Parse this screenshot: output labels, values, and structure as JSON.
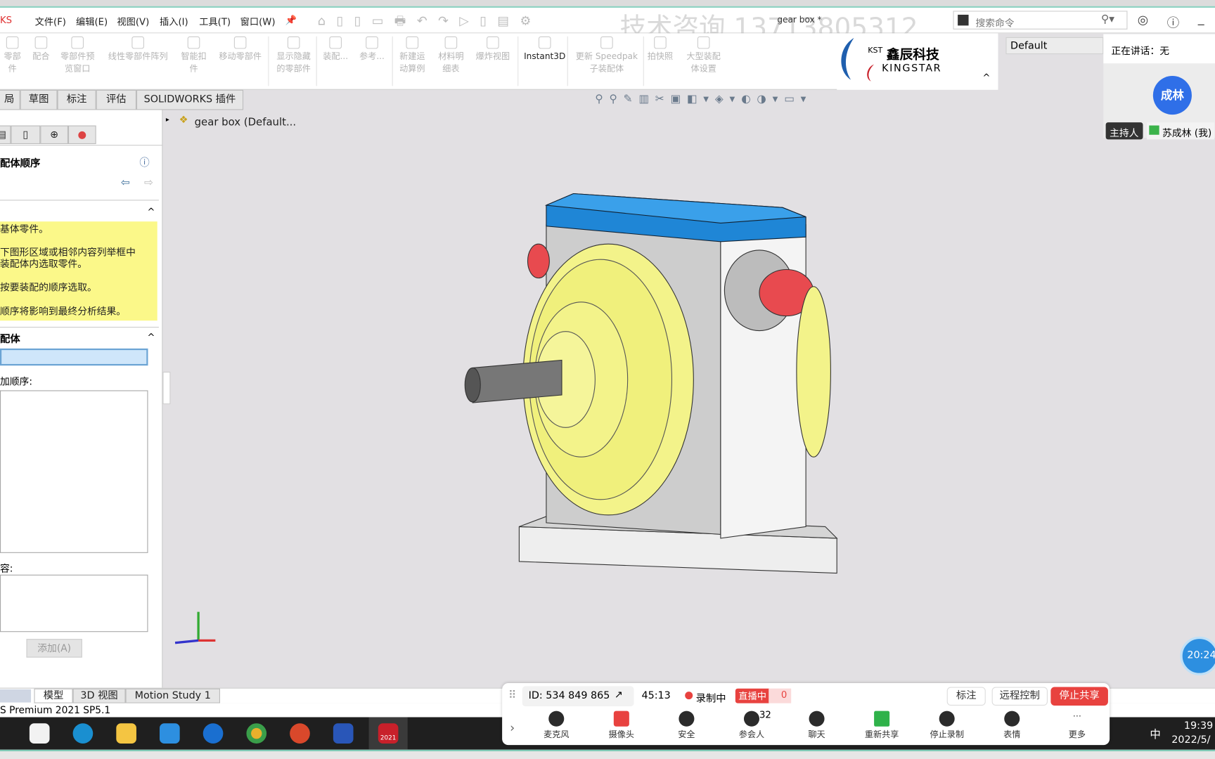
{
  "app": {
    "brand_fragment": "KS",
    "doc_title": "gear box *",
    "watermark": "技术咨询 13713805312"
  },
  "menu": [
    "文件(F)",
    "编辑(E)",
    "视图(V)",
    "插入(I)",
    "工具(T)",
    "窗口(W)"
  ],
  "search": {
    "placeholder": "搜索命令"
  },
  "ribbon": [
    {
      "l1": "零部件",
      "l2": ""
    },
    {
      "l1": "配合",
      "l2": ""
    },
    {
      "l1": "零部件预",
      "l2": "览窗口"
    },
    {
      "l1": "线性零部件阵列",
      "l2": ""
    },
    {
      "l1": "智能扣",
      "l2": "件"
    },
    {
      "l1": "移动零部件",
      "l2": ""
    },
    {
      "l1": "显示隐藏",
      "l2": "的零部件"
    },
    {
      "l1": "装配...",
      "l2": ""
    },
    {
      "l1": "参考...",
      "l2": ""
    },
    {
      "l1": "新建运",
      "l2": "动算例"
    },
    {
      "l1": "材料明",
      "l2": "细表"
    },
    {
      "l1": "爆炸视图",
      "l2": ""
    },
    {
      "l1": "Instant3D",
      "l2": ""
    },
    {
      "l1": "更新 Speedpak",
      "l2": "子装配体"
    },
    {
      "l1": "拍快照",
      "l2": ""
    },
    {
      "l1": "大型装配",
      "l2": "体设置"
    }
  ],
  "logo": {
    "cn": "鑫辰科技",
    "abbr": "KST",
    "en": "KINGSTAR"
  },
  "config": {
    "value": "Default"
  },
  "tabs": [
    "局",
    "草图",
    "标注",
    "评估",
    "SOLIDWORKS 插件"
  ],
  "tree": {
    "root": "gear box  (Default..."
  },
  "panel": {
    "title": "配体顺序",
    "section1_notes": [
      "基体零件。",
      "下图形区域或相邻内容列举框中",
      "装配体内选取零件。",
      "按要装配的顺序选取。",
      "顺序将影响到最终分析结果。"
    ],
    "section2_title": "配体",
    "order_label": "加顺序:",
    "second_label": "容:",
    "add_button": "添加(A)"
  },
  "bottom_tabs": [
    "模型",
    "3D 视图",
    "Motion Study 1"
  ],
  "status": "S Premium 2021 SP5.1",
  "meeting": {
    "speaking": "正在讲话：无",
    "avatar": "成林",
    "host_badge": "主持人",
    "user": "苏成林 (我)",
    "id": "ID: 534 849 865",
    "duration": "45:13",
    "recording": "录制中",
    "live": "直播中",
    "viewers": "0",
    "annotate": "标注",
    "remote": "远程控制",
    "stop_share": "停止共享",
    "participants_count": "32",
    "tools": [
      "麦克风",
      "摄像头",
      "安全",
      "参会人",
      "聊天",
      "重新共享",
      "停止录制",
      "表情",
      "更多"
    ],
    "timer": "20:24"
  },
  "taskbar": {
    "time": "19:39",
    "date": "2022/5/",
    "ime": "中",
    "sw_label": "2021"
  },
  "colors": {
    "viewport": "#e2e0e3",
    "lid": "#1f86d6",
    "cover": "#f3f38a",
    "knob": "#e84a4f",
    "meeting_red": "#e8423f",
    "avatar": "#2f6fe8"
  }
}
